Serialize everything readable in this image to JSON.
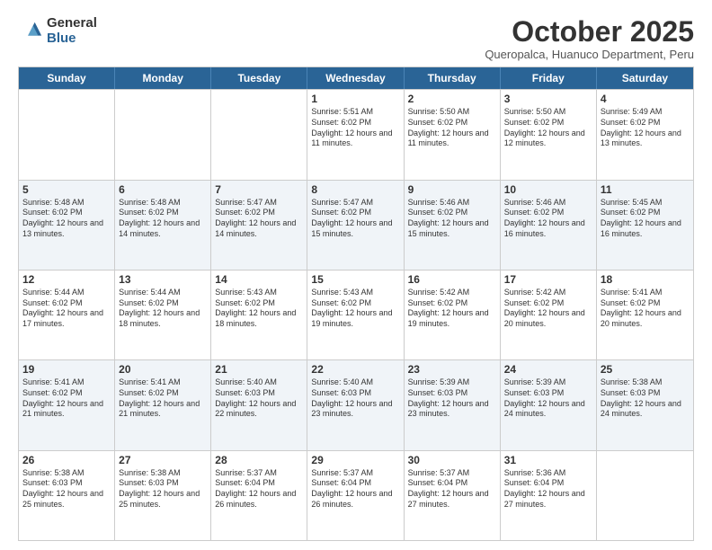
{
  "logo": {
    "general": "General",
    "blue": "Blue"
  },
  "header": {
    "month": "October 2025",
    "location": "Queropalca, Huanuco Department, Peru"
  },
  "weekdays": [
    "Sunday",
    "Monday",
    "Tuesday",
    "Wednesday",
    "Thursday",
    "Friday",
    "Saturday"
  ],
  "rows": [
    [
      {
        "day": "",
        "info": ""
      },
      {
        "day": "",
        "info": ""
      },
      {
        "day": "",
        "info": ""
      },
      {
        "day": "1",
        "info": "Sunrise: 5:51 AM\nSunset: 6:02 PM\nDaylight: 12 hours and 11 minutes."
      },
      {
        "day": "2",
        "info": "Sunrise: 5:50 AM\nSunset: 6:02 PM\nDaylight: 12 hours and 11 minutes."
      },
      {
        "day": "3",
        "info": "Sunrise: 5:50 AM\nSunset: 6:02 PM\nDaylight: 12 hours and 12 minutes."
      },
      {
        "day": "4",
        "info": "Sunrise: 5:49 AM\nSunset: 6:02 PM\nDaylight: 12 hours and 13 minutes."
      }
    ],
    [
      {
        "day": "5",
        "info": "Sunrise: 5:48 AM\nSunset: 6:02 PM\nDaylight: 12 hours and 13 minutes."
      },
      {
        "day": "6",
        "info": "Sunrise: 5:48 AM\nSunset: 6:02 PM\nDaylight: 12 hours and 14 minutes."
      },
      {
        "day": "7",
        "info": "Sunrise: 5:47 AM\nSunset: 6:02 PM\nDaylight: 12 hours and 14 minutes."
      },
      {
        "day": "8",
        "info": "Sunrise: 5:47 AM\nSunset: 6:02 PM\nDaylight: 12 hours and 15 minutes."
      },
      {
        "day": "9",
        "info": "Sunrise: 5:46 AM\nSunset: 6:02 PM\nDaylight: 12 hours and 15 minutes."
      },
      {
        "day": "10",
        "info": "Sunrise: 5:46 AM\nSunset: 6:02 PM\nDaylight: 12 hours and 16 minutes."
      },
      {
        "day": "11",
        "info": "Sunrise: 5:45 AM\nSunset: 6:02 PM\nDaylight: 12 hours and 16 minutes."
      }
    ],
    [
      {
        "day": "12",
        "info": "Sunrise: 5:44 AM\nSunset: 6:02 PM\nDaylight: 12 hours and 17 minutes."
      },
      {
        "day": "13",
        "info": "Sunrise: 5:44 AM\nSunset: 6:02 PM\nDaylight: 12 hours and 18 minutes."
      },
      {
        "day": "14",
        "info": "Sunrise: 5:43 AM\nSunset: 6:02 PM\nDaylight: 12 hours and 18 minutes."
      },
      {
        "day": "15",
        "info": "Sunrise: 5:43 AM\nSunset: 6:02 PM\nDaylight: 12 hours and 19 minutes."
      },
      {
        "day": "16",
        "info": "Sunrise: 5:42 AM\nSunset: 6:02 PM\nDaylight: 12 hours and 19 minutes."
      },
      {
        "day": "17",
        "info": "Sunrise: 5:42 AM\nSunset: 6:02 PM\nDaylight: 12 hours and 20 minutes."
      },
      {
        "day": "18",
        "info": "Sunrise: 5:41 AM\nSunset: 6:02 PM\nDaylight: 12 hours and 20 minutes."
      }
    ],
    [
      {
        "day": "19",
        "info": "Sunrise: 5:41 AM\nSunset: 6:02 PM\nDaylight: 12 hours and 21 minutes."
      },
      {
        "day": "20",
        "info": "Sunrise: 5:41 AM\nSunset: 6:02 PM\nDaylight: 12 hours and 21 minutes."
      },
      {
        "day": "21",
        "info": "Sunrise: 5:40 AM\nSunset: 6:03 PM\nDaylight: 12 hours and 22 minutes."
      },
      {
        "day": "22",
        "info": "Sunrise: 5:40 AM\nSunset: 6:03 PM\nDaylight: 12 hours and 23 minutes."
      },
      {
        "day": "23",
        "info": "Sunrise: 5:39 AM\nSunset: 6:03 PM\nDaylight: 12 hours and 23 minutes."
      },
      {
        "day": "24",
        "info": "Sunrise: 5:39 AM\nSunset: 6:03 PM\nDaylight: 12 hours and 24 minutes."
      },
      {
        "day": "25",
        "info": "Sunrise: 5:38 AM\nSunset: 6:03 PM\nDaylight: 12 hours and 24 minutes."
      }
    ],
    [
      {
        "day": "26",
        "info": "Sunrise: 5:38 AM\nSunset: 6:03 PM\nDaylight: 12 hours and 25 minutes."
      },
      {
        "day": "27",
        "info": "Sunrise: 5:38 AM\nSunset: 6:03 PM\nDaylight: 12 hours and 25 minutes."
      },
      {
        "day": "28",
        "info": "Sunrise: 5:37 AM\nSunset: 6:04 PM\nDaylight: 12 hours and 26 minutes."
      },
      {
        "day": "29",
        "info": "Sunrise: 5:37 AM\nSunset: 6:04 PM\nDaylight: 12 hours and 26 minutes."
      },
      {
        "day": "30",
        "info": "Sunrise: 5:37 AM\nSunset: 6:04 PM\nDaylight: 12 hours and 27 minutes."
      },
      {
        "day": "31",
        "info": "Sunrise: 5:36 AM\nSunset: 6:04 PM\nDaylight: 12 hours and 27 minutes."
      },
      {
        "day": "",
        "info": ""
      }
    ]
  ]
}
